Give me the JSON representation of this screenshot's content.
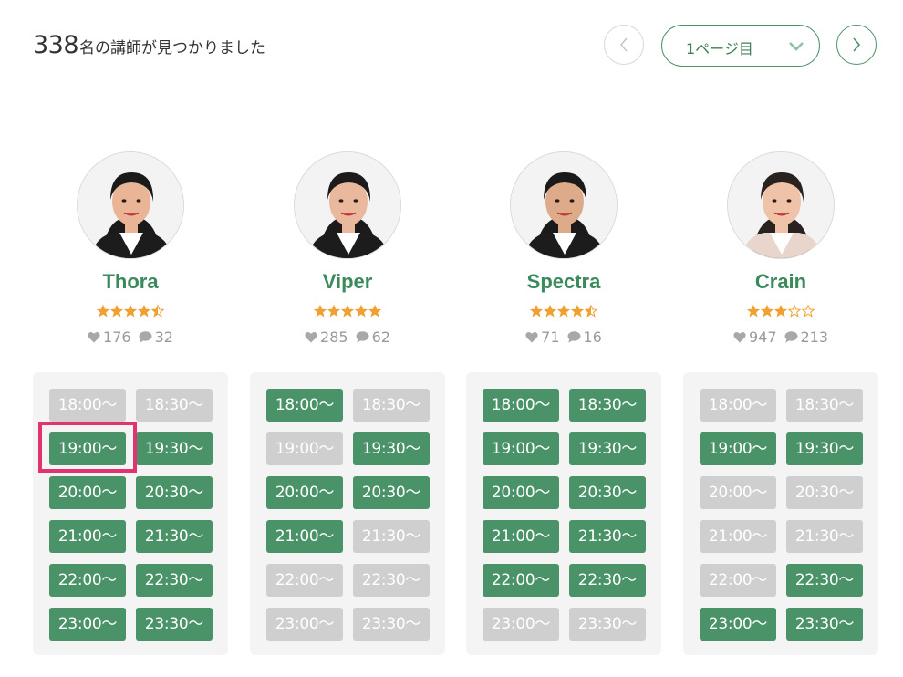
{
  "header": {
    "count": "338",
    "count_text": "名の講師が見つかりました",
    "page_label": "1ページ目"
  },
  "colors": {
    "accent": "#4a9267",
    "name": "#3a8a5c",
    "slot_unavailable": "#cfcfcf",
    "star": "#f0a030",
    "highlight": "#e0336f"
  },
  "tutors": [
    {
      "name": "Thora",
      "rating": 4.5,
      "favorites": "176",
      "reviews": "32",
      "slots": [
        {
          "time": "18:00〜",
          "available": false
        },
        {
          "time": "18:30〜",
          "available": false
        },
        {
          "time": "19:00〜",
          "available": true
        },
        {
          "time": "19:30〜",
          "available": true
        },
        {
          "time": "20:00〜",
          "available": true
        },
        {
          "time": "20:30〜",
          "available": true
        },
        {
          "time": "21:00〜",
          "available": true
        },
        {
          "time": "21:30〜",
          "available": true
        },
        {
          "time": "22:00〜",
          "available": true
        },
        {
          "time": "22:30〜",
          "available": true
        },
        {
          "time": "23:00〜",
          "available": true
        },
        {
          "time": "23:30〜",
          "available": true
        }
      ]
    },
    {
      "name": "Viper",
      "rating": 5,
      "favorites": "285",
      "reviews": "62",
      "slots": [
        {
          "time": "18:00〜",
          "available": true
        },
        {
          "time": "18:30〜",
          "available": false
        },
        {
          "time": "19:00〜",
          "available": false
        },
        {
          "time": "19:30〜",
          "available": true
        },
        {
          "time": "20:00〜",
          "available": true
        },
        {
          "time": "20:30〜",
          "available": true
        },
        {
          "time": "21:00〜",
          "available": true
        },
        {
          "time": "21:30〜",
          "available": false
        },
        {
          "time": "22:00〜",
          "available": false
        },
        {
          "time": "22:30〜",
          "available": false
        },
        {
          "time": "23:00〜",
          "available": false
        },
        {
          "time": "23:30〜",
          "available": false
        }
      ]
    },
    {
      "name": "Spectra",
      "rating": 4.5,
      "favorites": "71",
      "reviews": "16",
      "slots": [
        {
          "time": "18:00〜",
          "available": true
        },
        {
          "time": "18:30〜",
          "available": true
        },
        {
          "time": "19:00〜",
          "available": true
        },
        {
          "time": "19:30〜",
          "available": true
        },
        {
          "time": "20:00〜",
          "available": true
        },
        {
          "time": "20:30〜",
          "available": true
        },
        {
          "time": "21:00〜",
          "available": true
        },
        {
          "time": "21:30〜",
          "available": true
        },
        {
          "time": "22:00〜",
          "available": true
        },
        {
          "time": "22:30〜",
          "available": true
        },
        {
          "time": "23:00〜",
          "available": false
        },
        {
          "time": "23:30〜",
          "available": false
        }
      ]
    },
    {
      "name": "Crain",
      "rating": 3,
      "favorites": "947",
      "reviews": "213",
      "slots": [
        {
          "time": "18:00〜",
          "available": false
        },
        {
          "time": "18:30〜",
          "available": false
        },
        {
          "time": "19:00〜",
          "available": true
        },
        {
          "time": "19:30〜",
          "available": true
        },
        {
          "time": "20:00〜",
          "available": false
        },
        {
          "time": "20:30〜",
          "available": false
        },
        {
          "time": "21:00〜",
          "available": false
        },
        {
          "time": "21:30〜",
          "available": false
        },
        {
          "time": "22:00〜",
          "available": false
        },
        {
          "time": "22:30〜",
          "available": true
        },
        {
          "time": "23:00〜",
          "available": true
        },
        {
          "time": "23:30〜",
          "available": true
        }
      ]
    }
  ]
}
